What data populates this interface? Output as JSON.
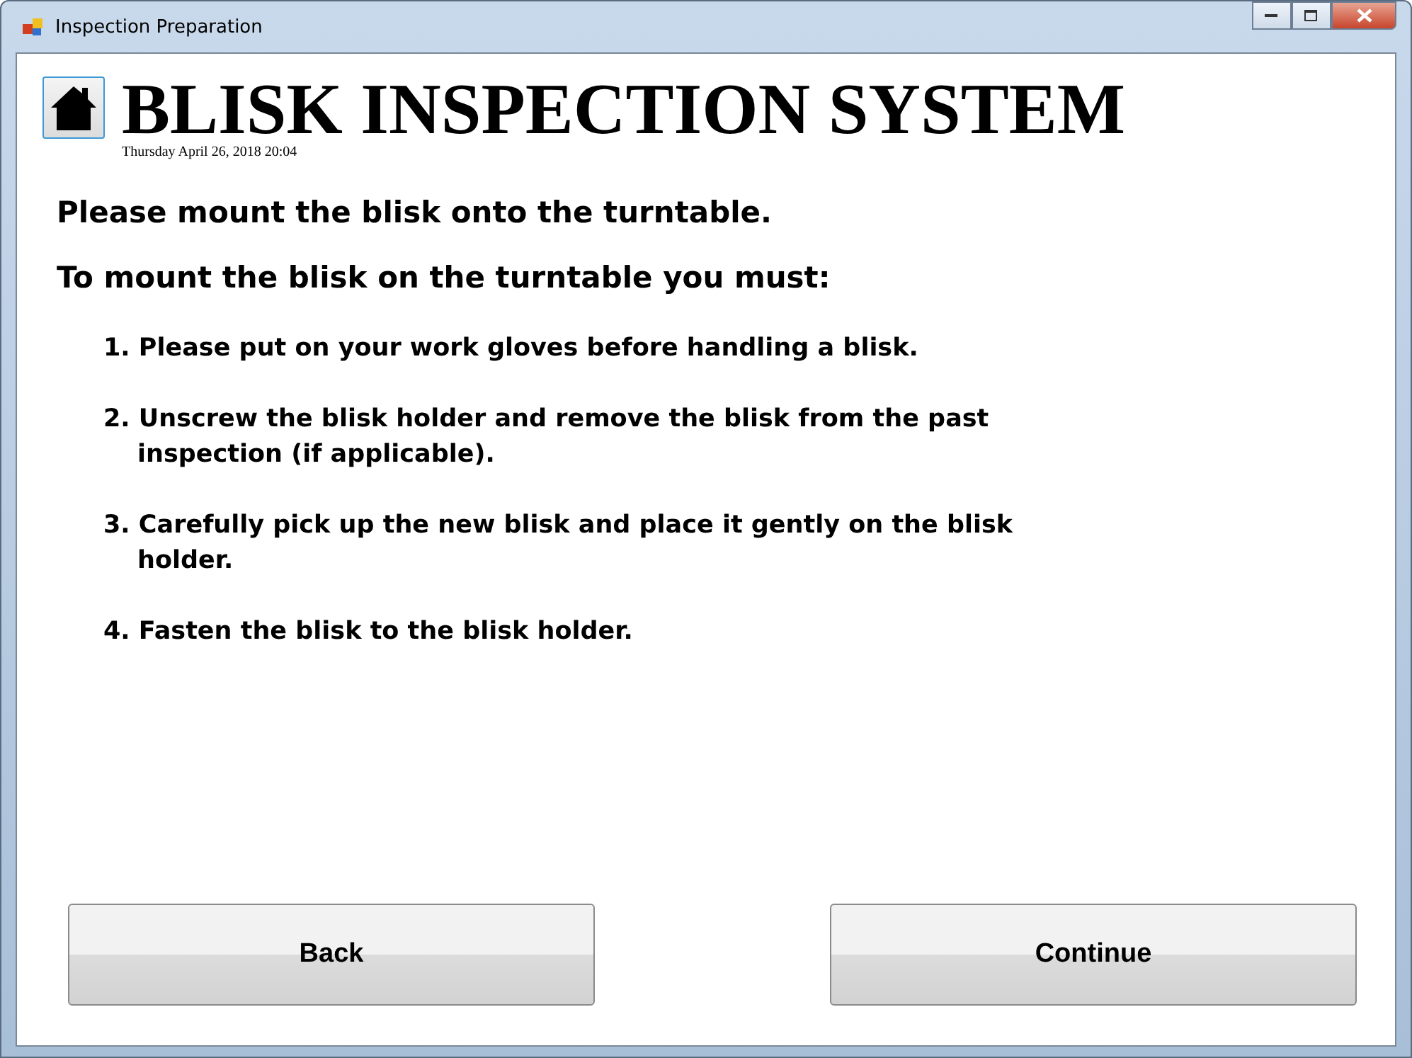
{
  "window": {
    "title": "Inspection Preparation"
  },
  "header": {
    "title": "BLISK INSPECTION SYSTEM",
    "datetime": "Thursday April 26, 2018 20:04"
  },
  "heading": "Please mount the blisk onto the turntable.",
  "subheading": "To mount the blisk on the turntable you must:",
  "steps": [
    "1. Please put on your work gloves before handling a blisk.",
    "2. Unscrew the blisk holder and remove the blisk from the past inspection (if applicable).",
    "3. Carefully pick up the new blisk and place it gently on the blisk holder.",
    "4. Fasten the blisk to the blisk holder."
  ],
  "buttons": [
    "Back",
    "Continue"
  ]
}
